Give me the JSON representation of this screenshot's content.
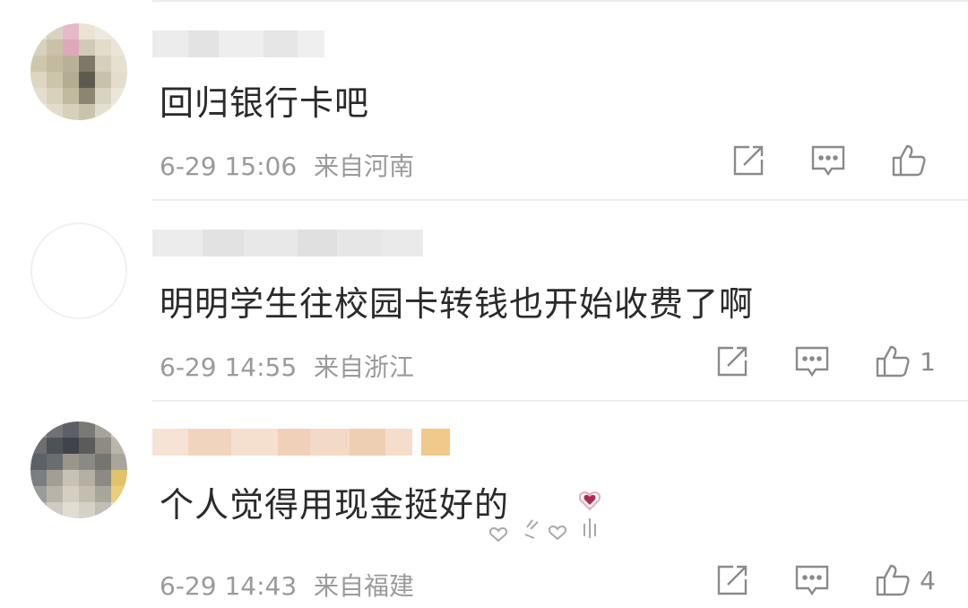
{
  "comments": [
    {
      "text": "回归银行卡吧",
      "time": "6-29 15:06",
      "location": "来自河南",
      "likes": "",
      "icons": [
        "share-icon",
        "comment-icon",
        "like-icon"
      ]
    },
    {
      "text": "明明学生往校园卡转钱也开始收费了啊",
      "time": "6-29 14:55",
      "location": "来自浙江",
      "likes": "1",
      "icons": [
        "share-icon",
        "comment-icon",
        "like-icon"
      ]
    },
    {
      "text": "个人觉得用现金挺好的",
      "time": "6-29 14:43",
      "location": "来自福建",
      "likes": "4",
      "icons": [
        "share-icon",
        "comment-icon",
        "like-icon"
      ],
      "sticker": "heart-hands-sticker"
    }
  ],
  "colors": {
    "text": "#2a2a2a",
    "meta": "#9a9a9a",
    "icon": "#8a8a8a",
    "divider": "#eeeeee"
  }
}
